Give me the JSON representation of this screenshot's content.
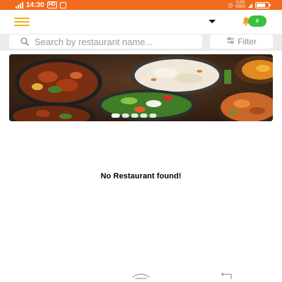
{
  "status_bar": {
    "carrier_left": "4G",
    "time": "14:30",
    "hd": "HD",
    "network_speed": "0.00\nKB/S",
    "battery_percent": 68
  },
  "header": {
    "location": "",
    "user_badge": "0"
  },
  "search": {
    "placeholder": "Search by restaurant name..."
  },
  "filter": {
    "label": "Filter"
  },
  "banner": {
    "slide_count": 5,
    "active_slide": 0
  },
  "main": {
    "empty_message": "No Restaurant found!"
  },
  "colors": {
    "status_bar": "#f26b1f",
    "menu_accent": "#e7b621",
    "badge": "#36c23d",
    "search_row_bg": "#ececec"
  },
  "icons": {
    "menu": "hamburger-icon",
    "search": "search-icon",
    "filter": "filter-icon",
    "notification": "bell-icon",
    "home": "home-nav-icon",
    "back": "back-nav-icon"
  }
}
